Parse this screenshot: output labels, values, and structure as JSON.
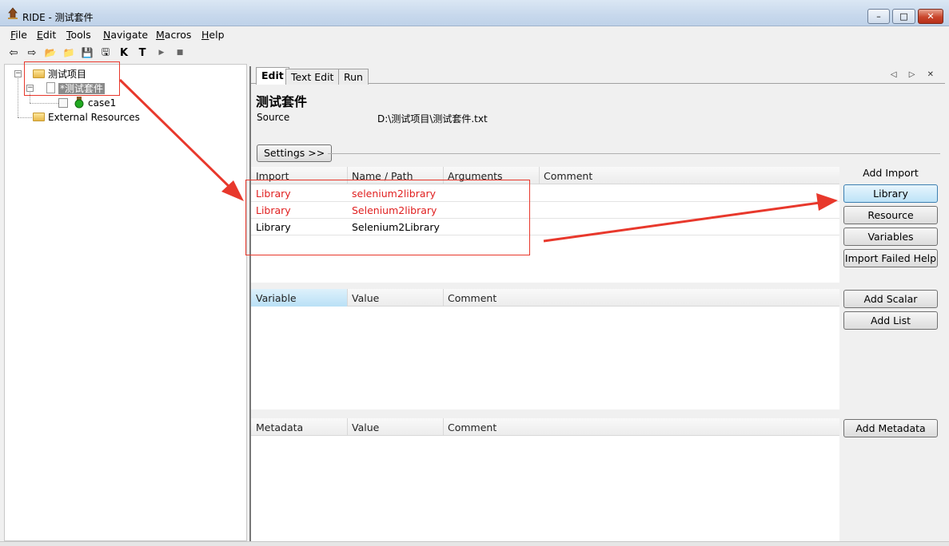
{
  "window": {
    "title": "RIDE - 测试套件",
    "minimize_glyph": "–",
    "maximize_glyph": "□",
    "close_glyph": "✕"
  },
  "menu": [
    "File",
    "Edit",
    "Tools",
    "Navigate",
    "Macros",
    "Help"
  ],
  "toolbar": {
    "icons": [
      "arrow-left-icon",
      "arrow-right-icon",
      "open-folder-icon",
      "open-directory-icon",
      "save-icon",
      "save-all-icon",
      "search-keywords-icon",
      "search-tests-icon",
      "run-icon",
      "stop-icon"
    ],
    "glyphs": [
      "⇦",
      "⇨",
      "📂",
      "📁",
      "💾",
      "🖫",
      "K",
      "T",
      "▶",
      "■"
    ]
  },
  "tree": {
    "project": "测试项目",
    "suite": "*测试套件",
    "testcase": "case1",
    "external": "External Resources",
    "expander_glyph": "−"
  },
  "tabs": [
    "Edit",
    "Text Edit",
    "Run"
  ],
  "tab_arrows": "◁ ▷ ✕",
  "editor": {
    "suite_title": "测试套件",
    "source_label": "Source",
    "source_value": "D:\\测试项目\\测试套件.txt",
    "settings_button": "Settings >>"
  },
  "import_table": {
    "headers": [
      "Import",
      "Name / Path",
      "Arguments",
      "Comment"
    ],
    "rows": [
      {
        "import": "Library",
        "name": "selenium2library",
        "arguments": "",
        "comment": ""
      },
      {
        "import": "Library",
        "name": "Selenium2library",
        "arguments": "",
        "comment": ""
      },
      {
        "import": "Library",
        "name": "Selenium2Library",
        "arguments": "",
        "comment": ""
      }
    ]
  },
  "variable_table": {
    "headers": [
      "Variable",
      "Value",
      "Comment"
    ]
  },
  "metadata_table": {
    "headers": [
      "Metadata",
      "Value",
      "Comment"
    ]
  },
  "side_panel": {
    "add_import_title": "Add Import",
    "library_button": "Library",
    "resource_button": "Resource",
    "variables_button": "Variables",
    "import_failed_button": "Import Failed Help",
    "add_scalar_button": "Add Scalar",
    "add_list_button": "Add List",
    "add_metadata_button": "Add Metadata"
  },
  "colors": {
    "annotation_red": "#e8382c",
    "error_text_red": "#e02020",
    "focus_blue": "#3c7fb1"
  }
}
